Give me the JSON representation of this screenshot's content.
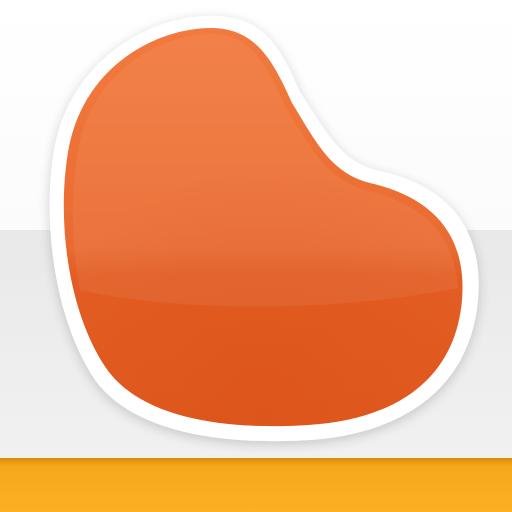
{
  "icon": {
    "name": "bean-app-icon",
    "colors": {
      "bean_light": "#f27a3e",
      "bean_dark": "#e05a20",
      "bean_outline": "#ffffff",
      "background_top": "#ffffff",
      "background_bottom": "#ececec",
      "accent_bar": "#fbb023"
    }
  }
}
